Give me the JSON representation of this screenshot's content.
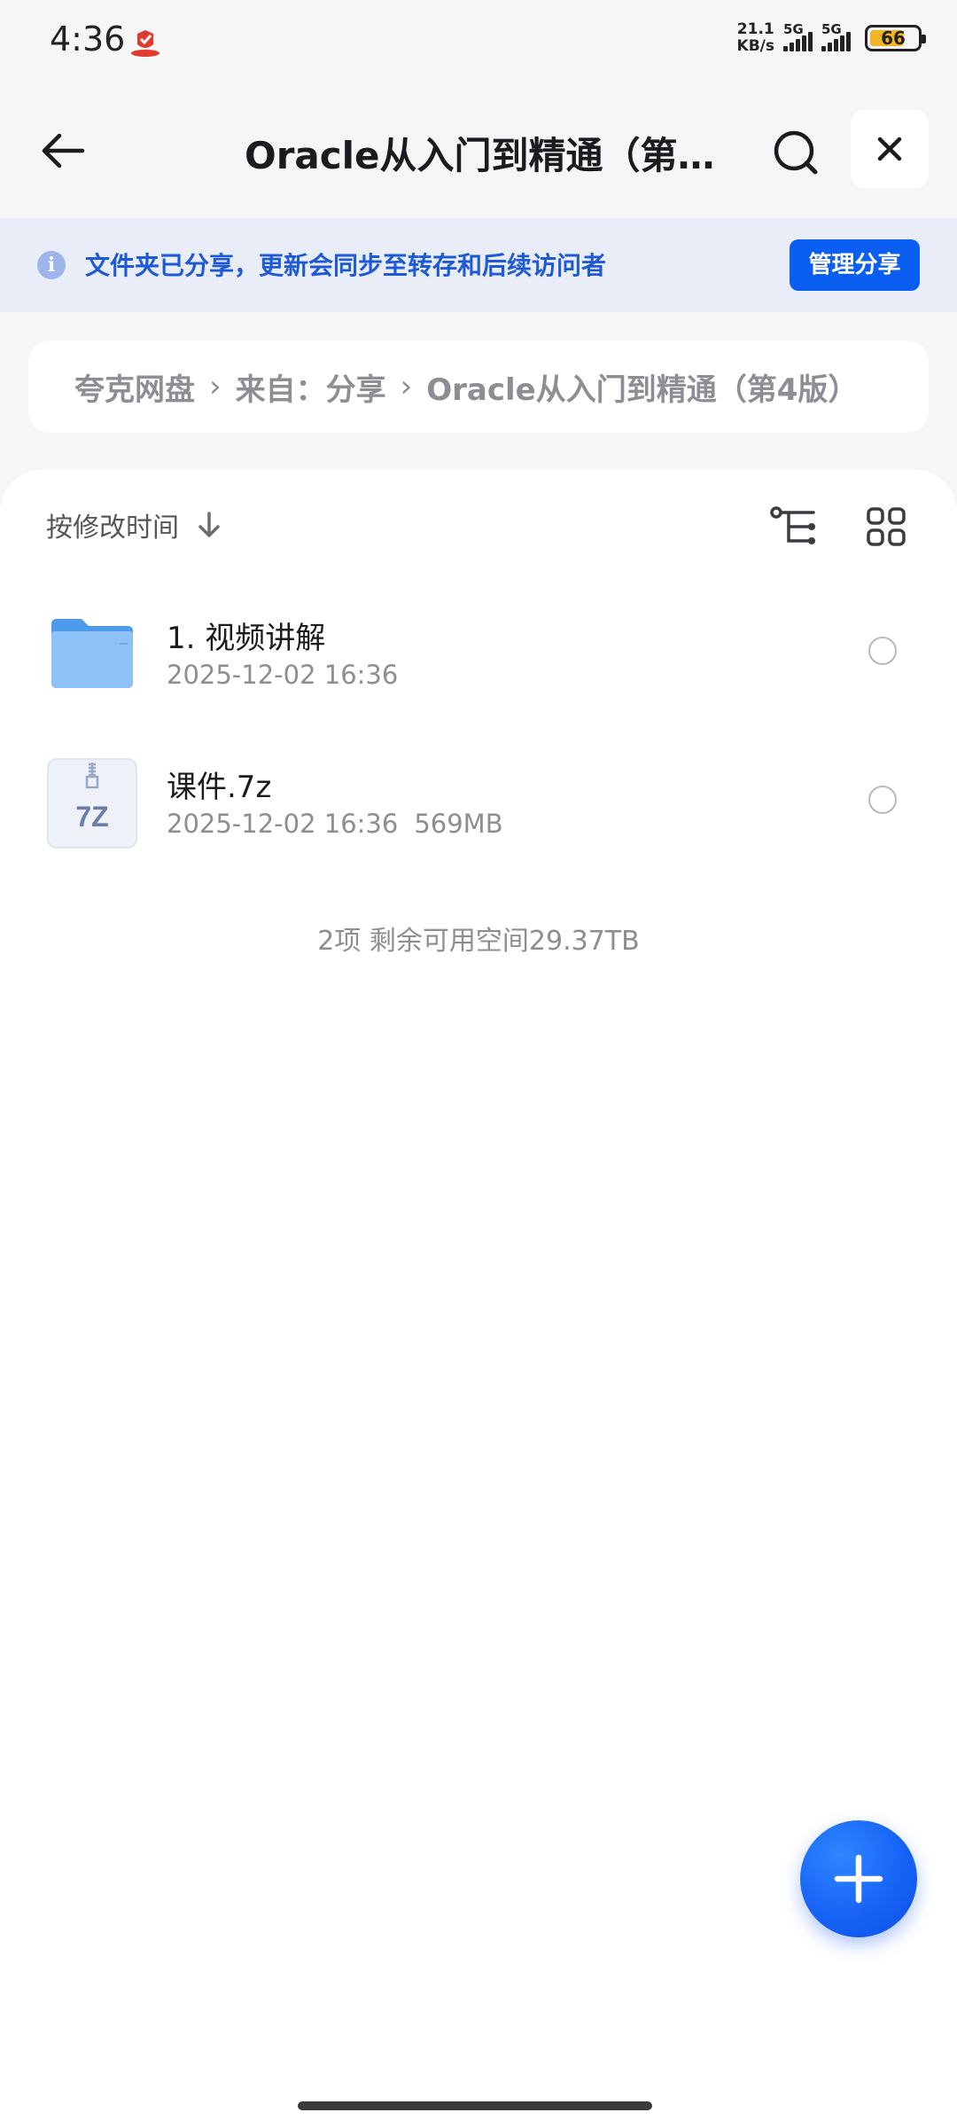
{
  "status_bar": {
    "time": "4:36",
    "net_speed_value": "21.1",
    "net_speed_unit": "KB/s",
    "sim1_tag": "5G",
    "sim2_tag": "5G",
    "battery_level": "66",
    "battery_color": "#f0b628"
  },
  "header": {
    "title": "Oracle从入门到精通（第4版）",
    "back_icon": "arrow-left-icon",
    "search_icon": "search-icon",
    "close_icon": "close-icon"
  },
  "share_banner": {
    "text": "文件夹已分享，更新会同步至转存和后续访问者",
    "button_label": "管理分享",
    "accent_color": "#0b5ef2"
  },
  "breadcrumb": {
    "items": [
      "夸克网盘",
      "来自：分享",
      "Oracle从入门到精通（第4版）"
    ],
    "separator": "›"
  },
  "toolbar": {
    "sort_label": "按修改时间",
    "sort_direction_icon": "arrow-down-icon",
    "tree_view_icon": "tree-view-icon",
    "grid_view_icon": "grid-view-icon"
  },
  "files": [
    {
      "name": "1. 视频讲解",
      "modified": "2025-12-02 16:36",
      "size": "",
      "icon": "folder-icon"
    },
    {
      "name": "课件.7z",
      "modified": "2025-12-02 16:36",
      "size": "569MB",
      "icon": "archive-7z-icon",
      "icon_label": "7Z"
    }
  ],
  "summary": "2项 剩余可用空间29.37TB",
  "fab": {
    "icon": "plus-icon"
  }
}
